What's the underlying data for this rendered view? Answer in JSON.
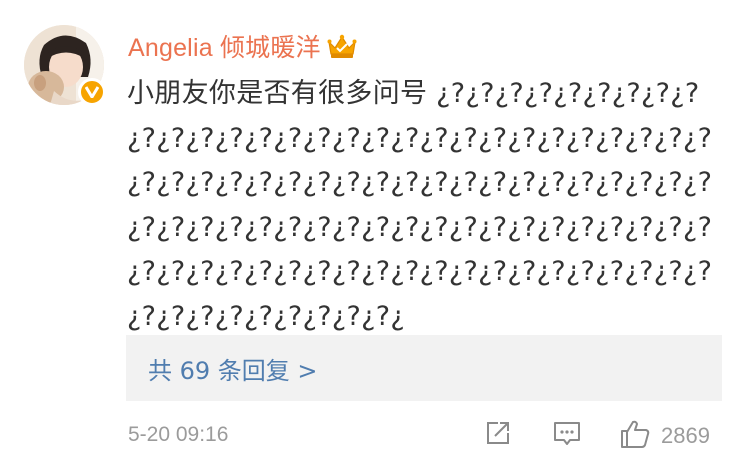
{
  "comment": {
    "user": {
      "name": "Angelia 倾城暖洋",
      "verified_icon": "v-badge-icon",
      "member_icon": "crown-icon"
    },
    "text": "小朋友你是否有很多问号 ¿?¿?¿?¿?¿?¿?¿?¿?¿?¿?¿?¿?¿?¿?¿?¿?¿?¿?¿?¿?¿?¿?¿?¿?¿?¿?¿?¿?¿?¿?¿?¿?¿?¿?¿?¿?¿?¿?¿?¿?¿?¿?¿?¿?¿?¿?¿?¿?¿?¿?¿?¿?¿?¿?¿?¿?¿?¿?¿?¿?¿?¿?¿?¿?¿?¿?¿?¿?¿?¿?¿?¿?¿?¿?¿?¿?¿?¿?¿?¿?¿?¿?¿?¿?¿?¿?¿?¿?¿?¿?¿?¿?¿?¿?¿?¿?¿?¿?¿",
    "replies_label": "共 69 条回复 >",
    "timestamp": "5-20 09:16",
    "actions": {
      "share_icon": "share-icon",
      "comment_icon": "comment-icon",
      "like_icon": "thumbs-up-icon",
      "like_count": "2869"
    },
    "colors": {
      "username": "#eb7350",
      "link": "#507daf",
      "meta": "#9b9b9b",
      "reply_bg": "#f2f2f2",
      "badge": "#f7a400"
    }
  }
}
